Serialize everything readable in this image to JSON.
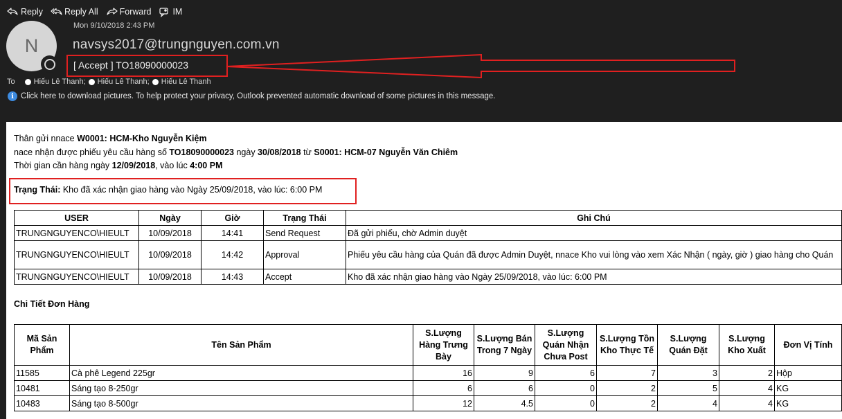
{
  "toolbar": {
    "reply": "Reply",
    "reply_all": "Reply All",
    "forward": "Forward",
    "im": "IM"
  },
  "message": {
    "avatar_initial": "N",
    "date": "Mon 9/10/2018 2:43 PM",
    "sender": "navsys2017@trungnguyen.com.vn",
    "subject": "[ Accept ] TO18090000023",
    "to_label": "To",
    "recipients": [
      "Hiếu Lê Thanh;",
      "Hiếu Lê Thanh;",
      "Hiếu Lê Thanh"
    ],
    "info_bar": "Click here to download pictures. To help protect your privacy, Outlook prevented automatic download of some pictures in this message."
  },
  "body": {
    "line1_prefix": "Thân gửi nnace ",
    "line1_bold": "W0001: HCM-Kho Nguyễn Kiệm",
    "line2_a": "nace nhận được phiếu yêu cầu hàng số ",
    "line2_num": "TO18090000023",
    "line2_b": " ngày ",
    "line2_date": "30/08/2018",
    "line2_c": " từ ",
    "line2_from": "S0001: HCM-07 Nguyễn Văn Chiêm",
    "line3_a": "Thời gian cần hàng ngày ",
    "line3_date": "12/09/2018",
    "line3_b": ", vào lúc ",
    "line3_time": "4:00 PM",
    "status_label": "Trạng Thái:",
    "status_text": " Kho đã xác nhận giao hàng vào Ngày 25/09/2018, vào lúc: 6:00 PM",
    "section_title": "Chi Tiết Đơn Hàng"
  },
  "log_table": {
    "headers": [
      "USER",
      "Ngày",
      "Giờ",
      "Trạng Thái",
      "Ghi Chú"
    ],
    "rows": [
      [
        "TRUNGNGUYENCO\\HIEULT",
        "10/09/2018",
        "14:41",
        "Send Request",
        "Đã gửi phiếu, chờ Admin duyệt"
      ],
      [
        "TRUNGNGUYENCO\\HIEULT",
        "10/09/2018",
        "14:42",
        "Approval",
        "Phiếu yêu cầu hàng của Quán đã được Admin Duyệt, nnace Kho vui lòng vào xem Xác Nhận ( ngày, giờ ) giao hàng cho Quán"
      ],
      [
        "TRUNGNGUYENCO\\HIEULT",
        "10/09/2018",
        "14:43",
        "Accept",
        "Kho đã xác nhận giao hàng vào Ngày 25/09/2018, vào lúc: 6:00 PM"
      ]
    ]
  },
  "items_table": {
    "headers": [
      "Mã Sản Phẩm",
      "Tên Sản Phẩm",
      "S.Lượng Hàng Trưng Bày",
      "S.Lượng Bán Trong 7 Ngày",
      "S.Lượng Quán Nhận Chưa Post",
      "S.Lượng Tồn Kho Thực Tế",
      "S.Lượng Quán Đặt",
      "S.Lượng Kho Xuất",
      "Đơn Vị Tính"
    ],
    "rows": [
      [
        "11585",
        "Cà phê Legend 225gr",
        "16",
        "9",
        "6",
        "7",
        "3",
        "2",
        "Hộp"
      ],
      [
        "10481",
        "Sáng tạo 8-250gr",
        "6",
        "6",
        "0",
        "2",
        "5",
        "4",
        "KG"
      ],
      [
        "10483",
        "Sáng tạo 8-500gr",
        "12",
        "4.5",
        "0",
        "2",
        "4",
        "4",
        "KG"
      ]
    ]
  }
}
